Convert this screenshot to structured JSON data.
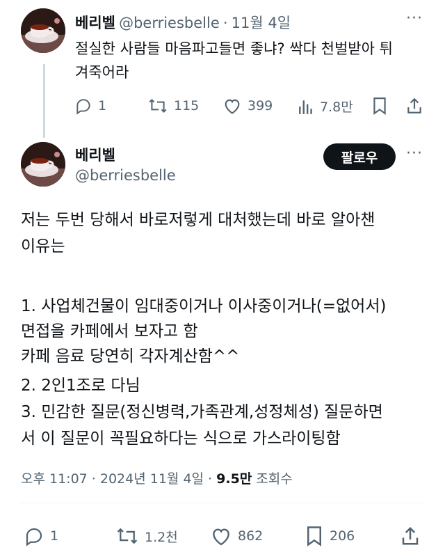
{
  "reply_tweet": {
    "display_name": "베리벨",
    "handle": "@berriesbelle",
    "separator": "·",
    "date": "11월 4일",
    "text_lines": [
      "절실한 사람들 마음파고들면 좋냐? 싹다 천벌받아 튀",
      "겨죽어라"
    ],
    "stats": {
      "replies": "1",
      "retweets": "115",
      "likes": "399",
      "views": "7.8만"
    }
  },
  "main_tweet": {
    "display_name": "베리벨",
    "handle": "@berriesbelle",
    "follow_label": "팔로우",
    "text_lines": [
      "저는 두번 당해서 바로저렇게 대처했는데 바로 알아챈",
      "이유는",
      "",
      "1. 사업체건물이 임대중이거나 이사중이거나(=없어서)",
      "면접을 카페에서 보자고 함",
      "카페 음료 당연히 각자계산함^^",
      "2. 2인1조로 다님",
      "3. 민감한 질문(정신병력,가족관계,성정체성) 질문하면",
      "서 이 질문이 꼭필요하다는 식으로 가스라이팅함"
    ],
    "timestamp": "오후 11:07 · 2024년 11월 4일 ·",
    "view_count": "9.5만",
    "view_label": "조회수",
    "stats": {
      "replies": "1",
      "retweets": "1.2천",
      "likes": "862",
      "bookmarks": "206"
    }
  },
  "colors": {
    "text": "#0f1419",
    "muted": "#536471",
    "line": "#cfd9de",
    "button_bg": "#0f1419"
  },
  "icons": [
    "more-icon",
    "reply-icon",
    "retweet-icon",
    "like-icon",
    "views-icon",
    "bookmark-icon",
    "share-icon"
  ]
}
